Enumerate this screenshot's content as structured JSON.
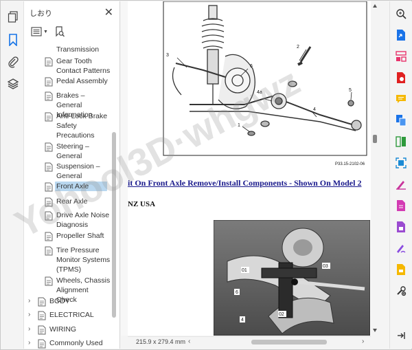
{
  "bookmarks_panel": {
    "title": "しおり",
    "items": [
      {
        "label": "Transmission",
        "level": "sub",
        "partial": true
      },
      {
        "label": "Gear Tooth Contact Patterns",
        "level": "sub"
      },
      {
        "label": "Pedal Assembly",
        "level": "sub"
      },
      {
        "label": "Brakes – General Information",
        "level": "sub"
      },
      {
        "label": "Anti-Lock Brake Safety Precautions",
        "level": "sub"
      },
      {
        "label": "Steering – General",
        "level": "sub"
      },
      {
        "label": "Suspension – General",
        "level": "sub"
      },
      {
        "label": "Front Axle",
        "level": "sub",
        "selected": true
      },
      {
        "label": "Rear Axle",
        "level": "sub"
      },
      {
        "label": "Drive Axle Noise Diagnosis",
        "level": "sub"
      },
      {
        "label": "Propeller Shaft",
        "level": "sub"
      },
      {
        "label": "Tire Pressure Monitor Systems (TPMS)",
        "level": "sub"
      },
      {
        "label": "Wheels, Chassis Alignment Check",
        "level": "sub"
      },
      {
        "label": "BODY",
        "level": "top"
      },
      {
        "label": "ELECTRICAL",
        "level": "top"
      },
      {
        "label": "WIRING",
        "level": "top"
      },
      {
        "label": "Commonly Used",
        "level": "top",
        "partial": true
      }
    ]
  },
  "document": {
    "heading": "it On Front Axle Remove/Install Components - Shown On Model 2",
    "models": "NZ USA",
    "figure1": {
      "callouts": [
        "1",
        "2",
        "3",
        "4",
        "4a",
        "5",
        "6"
      ],
      "ref": "P33.15-2102-06"
    },
    "figure2": {
      "callouts": [
        "01",
        "02",
        "03",
        "4",
        "6"
      ]
    },
    "page_size": "215.9 x 279.4 mm"
  },
  "watermark": "Yohool3D·whgwz",
  "colors": {
    "selection": "#b9d7ef",
    "link": "#1a1a8c",
    "bookmark_icon": "#1473e6"
  }
}
